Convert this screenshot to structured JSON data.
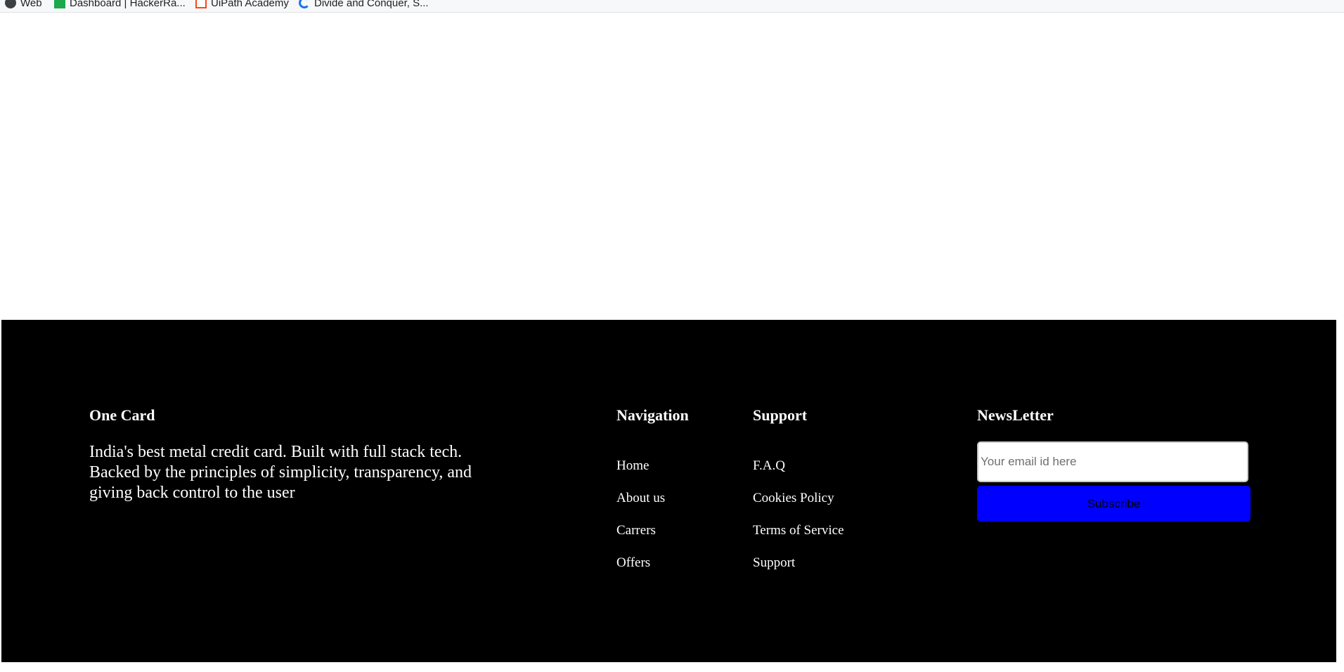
{
  "bookmarks": [
    {
      "label": "Web",
      "icon": "wordpress-icon"
    },
    {
      "label": "Dashboard | HackerRa...",
      "icon": "hackerrank-icon"
    },
    {
      "label": "UiPath Academy",
      "icon": "uipath-icon"
    },
    {
      "label": "Divide and Conquer, S...",
      "icon": "google-icon"
    }
  ],
  "footer": {
    "brand": {
      "title": "One Card",
      "description": "India's best metal credit card. Built with full stack tech. Backed by the principles of simplicity, transparency, and giving back control to the user"
    },
    "navigation": {
      "title": "Navigation",
      "links": [
        "Home",
        "About us",
        "Carrers",
        "Offers"
      ]
    },
    "support": {
      "title": "Support",
      "links": [
        "F.A.Q",
        "Cookies Policy",
        "Terms of Service",
        "Support"
      ]
    },
    "newsletter": {
      "title": "NewsLetter",
      "placeholder": "Your email id here",
      "button_label": "Subscribe"
    }
  },
  "colors": {
    "footer_background": "#000000",
    "subscribe_button": "#0000ff"
  }
}
